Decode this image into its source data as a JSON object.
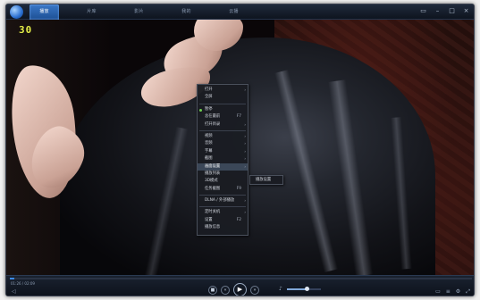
{
  "window": {
    "tabs": [
      {
        "label": "播放",
        "active": true
      },
      {
        "label": "片库",
        "active": false
      },
      {
        "label": "影片",
        "active": false
      },
      {
        "label": "我的",
        "active": false
      },
      {
        "label": "云播",
        "active": false
      }
    ],
    "controls": {
      "menu": "▭",
      "minimize": "–",
      "maximize": "□",
      "close": "×"
    }
  },
  "video": {
    "fps_overlay": "30"
  },
  "context_menu": {
    "items": [
      {
        "label": "打开",
        "shortcut": "",
        "arrow": "›"
      },
      {
        "label": "全屏",
        "shortcut": "",
        "arrow": ""
      },
      {
        "label": "暂停",
        "shortcut": "",
        "arrow": "",
        "dot": true
      },
      {
        "label": "总在最前",
        "shortcut": "F7",
        "arrow": ""
      },
      {
        "label": "打开目录",
        "shortcut": "",
        "arrow": "›"
      },
      {
        "label": "视频",
        "shortcut": "",
        "arrow": "›"
      },
      {
        "label": "音频",
        "shortcut": "",
        "arrow": "›"
      },
      {
        "label": "字幕",
        "shortcut": "",
        "arrow": "›"
      },
      {
        "label": "截图",
        "shortcut": "",
        "arrow": "›"
      },
      {
        "label": "画面设置",
        "shortcut": "",
        "arrow": "›",
        "highlight": true
      },
      {
        "label": "播放列表",
        "shortcut": "",
        "arrow": ""
      },
      {
        "label": "3D模式",
        "shortcut": "",
        "arrow": ""
      },
      {
        "label": "任务截图",
        "shortcut": "F9",
        "arrow": ""
      },
      {
        "label": "DLNA / 外部播放",
        "shortcut": "",
        "arrow": "›",
        "sep_before": true
      },
      {
        "label": "定时关机",
        "shortcut": "",
        "arrow": "›",
        "sep_before": true
      },
      {
        "label": "设置",
        "shortcut": "F2",
        "arrow": ""
      },
      {
        "label": "播放信息",
        "shortcut": "",
        "arrow": ""
      }
    ],
    "submenu_label": "播放设置"
  },
  "player": {
    "time": "01:26 / 02:09",
    "progress": 0.01,
    "buttons": {
      "stop": "■",
      "prev": "«",
      "play": "▶",
      "next": "»"
    },
    "volume_icon": "♪",
    "volume": 0.6,
    "right_icons": [
      "▭",
      "≡",
      "⚙",
      "⤢"
    ],
    "left_icon": "◁"
  },
  "colors": {
    "accent": "#3d8ae8",
    "tab_active": "#2a64b0",
    "fps_text": "#e8f04a",
    "menu_bg": "#1a1c22"
  }
}
